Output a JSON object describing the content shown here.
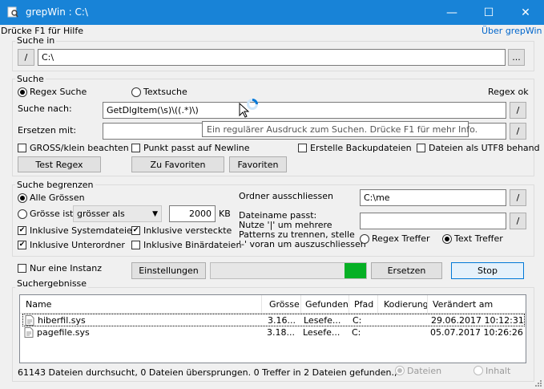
{
  "window": {
    "title": "grepWin : C:\\",
    "minimize": "—",
    "maximize": "☐",
    "close": "✕"
  },
  "header": {
    "help": "Drücke F1 für Hilfe",
    "about": "Über grepWin"
  },
  "search_in": {
    "label": "Suche in",
    "slash": "/",
    "path": "C:\\",
    "browse": "..."
  },
  "search": {
    "label": "Suche",
    "regex_label": "Regex Suche",
    "text_label": "Textsuche",
    "regex_status": "Regex ok",
    "find_label": "Suche nach:",
    "find_value": "GetDlgItem(\\s)\\((.*)\\)",
    "replace_label": "Ersetzen mit:",
    "replace_value": "",
    "slash": "/",
    "tooltip": "Ein regulärer Ausdruck zum Suchen. Drücke F1 für mehr Info.",
    "case_label": "GROSS/klein beachten",
    "dot_label": "Punkt passt auf Newline",
    "backup_label": "Erstelle Backupdateien",
    "utf8_label": "Dateien als UTF8 behand",
    "test_regex": "Test Regex",
    "to_favorites": "Zu Favoriten",
    "favorites": "Favoriten"
  },
  "limits": {
    "label": "Suche begrenzen",
    "all_sizes": "Alle Grössen",
    "size_is": "Grösse ist",
    "size_op": "grösser als",
    "size_value": "2000",
    "size_unit": "KB",
    "sys_files": "Inklusive Systemdateien",
    "hidden_files": "Inklusive versteckte",
    "subfolders": "Inklusive Unterordner",
    "binary_files": "Inklusive Binärdateien",
    "exclude_label": "Ordner ausschliessen",
    "exclude_value": "C:\\me",
    "filename_label": "Dateiname passt:",
    "filename_help": [
      "Nutze '|' um mehrere",
      "Patterns zu trennen, stelle",
      "'-' voran um auszuschliessen"
    ],
    "filename_value": "",
    "regex_match": "Regex Treffer",
    "text_match": "Text Treffer",
    "slash": "/"
  },
  "actions": {
    "single_instance": "Nur eine Instanz",
    "settings": "Einstellungen",
    "progress": 0.14,
    "replace": "Ersetzen",
    "stop": "Stop"
  },
  "results": {
    "label": "Suchergebnisse",
    "columns": [
      "Name",
      "Grösse",
      "Gefunden",
      "Pfad",
      "Kodierung",
      "Verändert am"
    ],
    "rows": [
      [
        "hiberfil.sys",
        "3.16...",
        "Lesefe...",
        "C:",
        "",
        "29.06.2017 10:12:31"
      ],
      [
        "pagefile.sys",
        "3.18...",
        "Lesefe...",
        "C:",
        "",
        "05.07.2017 10:26:26"
      ]
    ]
  },
  "status": {
    "text": "61143 Dateien durchsucht, 0 Dateien übersprungen. 0 Treffer in 2 Dateien gefunden.,",
    "files": "Dateien",
    "content": "Inhalt"
  },
  "colors": {
    "titlebar": "#1883d7",
    "progress": "#06b025",
    "accent": "#0078d7"
  }
}
